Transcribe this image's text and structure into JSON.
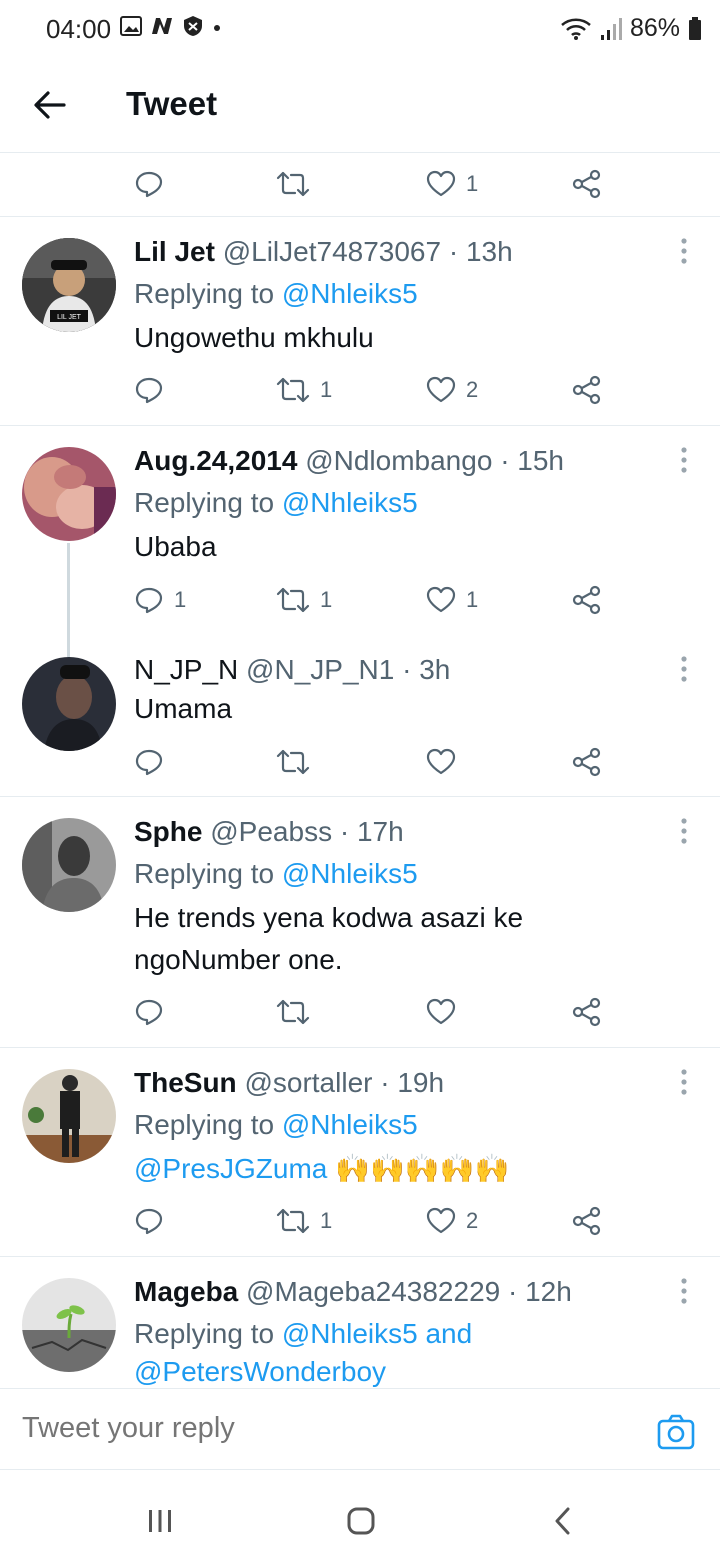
{
  "status": {
    "time": "04:00",
    "battery": "86%"
  },
  "header": {
    "title": "Tweet"
  },
  "prev_actions": {
    "like_count": "1"
  },
  "tweets": [
    {
      "name": "Lil Jet",
      "handle": "@LilJet74873067",
      "time": "· 13h",
      "replying_prefix": "Replying to",
      "replying_to": "@Nhleiks5",
      "text": "Ungowethu mkhulu",
      "avatar_label": "LIL JET",
      "reply_count": "",
      "retweet_count": "1",
      "like_count": "2"
    },
    {
      "name": "Aug.24,2014",
      "handle": "@Ndlombango",
      "time": "· 15h",
      "replying_prefix": "Replying to",
      "replying_to": "@Nhleiks5",
      "text": "Ubaba",
      "reply_count": "1",
      "retweet_count": "1",
      "like_count": "1"
    },
    {
      "name": "N_JP_N",
      "handle": "@N_JP_N1",
      "time": "· 3h",
      "text": "Umama",
      "reply_count": "",
      "retweet_count": "",
      "like_count": ""
    },
    {
      "name": "Sphe",
      "handle": "@Peabss",
      "time": "· 17h",
      "replying_prefix": "Replying to",
      "replying_to": "@Nhleiks5",
      "text_line1": "He trends yena kodwa asazi ke",
      "text_line2": "ngoNumber one.",
      "reply_count": "",
      "retweet_count": "",
      "like_count": ""
    },
    {
      "name": "TheSun",
      "handle": "@sortaller",
      "time": "· 19h",
      "replying_prefix": "Replying to",
      "replying_to": "@Nhleiks5",
      "mention": "@PresJGZuma",
      "emoji": "🙌🙌🙌🙌🙌",
      "reply_count": "",
      "retweet_count": "1",
      "like_count": "2"
    },
    {
      "name": "Mageba",
      "handle": "@Mageba24382229",
      "time": "· 12h",
      "replying_prefix": "Replying to",
      "replying_to": "@Nhleiks5 and",
      "replying_to2": "@PetersWonderboy"
    }
  ],
  "reply_box": {
    "placeholder": "Tweet your reply"
  },
  "colors": {
    "link": "#1d9bf0",
    "muted": "#536471",
    "text": "#0f1419",
    "divider": "#e6ecf0"
  }
}
